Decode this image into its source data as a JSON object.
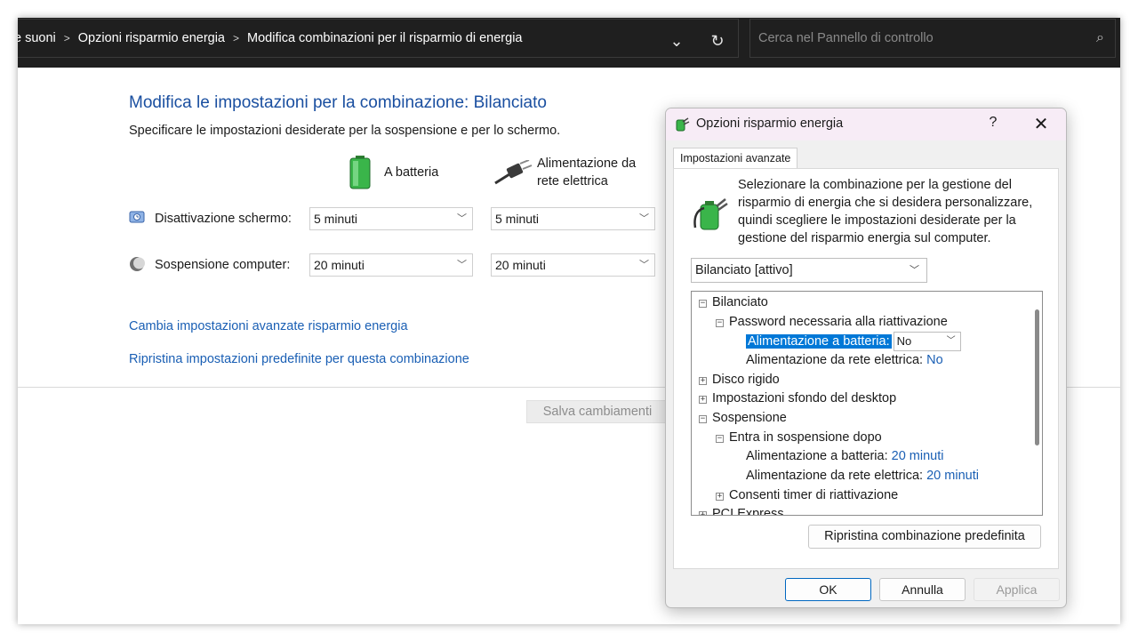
{
  "window": {
    "breadcrumbs": [
      "e suoni",
      "Opzioni risparmio energia",
      "Modifica combinazioni per il risparmio di energia"
    ],
    "search_placeholder": "Cerca nel Pannello di controllo"
  },
  "main": {
    "title": "Modifica le impostazioni per la combinazione: Bilanciato",
    "subtitle": "Specificare le impostazioni desiderate per la sospensione e per lo schermo.",
    "battery_header": "A batteria",
    "ac_header_line1": "Alimentazione da",
    "ac_header_line2": "rete elettrica",
    "rows": [
      {
        "label": "Disattivazione schermo:",
        "battery": "5 minuti",
        "ac": "5 minuti"
      },
      {
        "label": "Sospensione computer:",
        "battery": "20 minuti",
        "ac": "20 minuti"
      }
    ],
    "link_advanced": "Cambia impostazioni avanzate risparmio energia",
    "link_restore": "Ripristina impostazioni predefinite per questa combinazione",
    "save_button": "Salva cambiamenti"
  },
  "dialog": {
    "title": "Opzioni risparmio energia",
    "help": "?",
    "close": "✕",
    "tab": "Impostazioni avanzate",
    "description": "Selezionare la combinazione per la gestione del risparmio di energia che si desidera personalizzare, quindi scegliere le impostazioni desiderate per la gestione del risparmio energia sul computer.",
    "plan_select": "Bilanciato [attivo]",
    "tree": {
      "plan": "Bilanciato",
      "password": "Password necessaria alla riattivazione",
      "battery_label": "Alimentazione a batteria:",
      "battery_value": "No",
      "ac_label": "Alimentazione da rete elettrica:",
      "ac_value": "No",
      "hard_disk": "Disco rigido",
      "desktop_bg": "Impostazioni sfondo del desktop",
      "sleep": "Sospensione",
      "sleep_after": "Entra in sospensione dopo",
      "sleep_battery_label": "Alimentazione a batteria:",
      "sleep_battery_value": "20 minuti",
      "sleep_ac_label": "Alimentazione da rete elettrica:",
      "sleep_ac_value": "20 minuti",
      "wake_timers": "Consenti timer di riattivazione",
      "pci": "PCI Express"
    },
    "restore_button": "Ripristina combinazione predefinita",
    "ok": "OK",
    "cancel": "Annulla",
    "apply": "Applica"
  }
}
